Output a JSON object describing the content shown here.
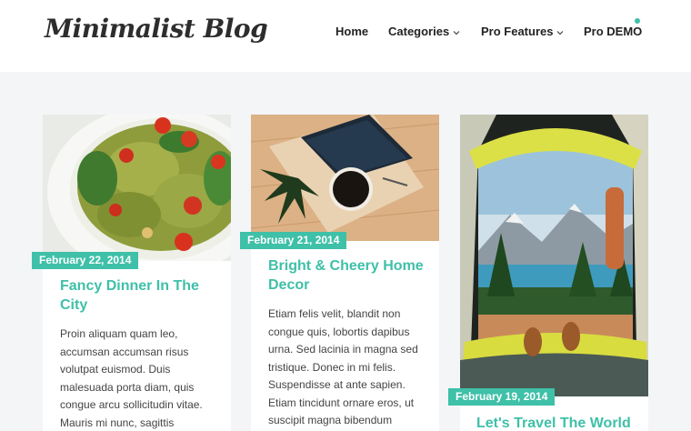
{
  "site": {
    "logo_text": "Minimalist Blog"
  },
  "nav": {
    "items": [
      {
        "label": "Home",
        "has_dropdown": false
      },
      {
        "label": "Categories",
        "has_dropdown": true
      },
      {
        "label": "Pro Features",
        "has_dropdown": true
      },
      {
        "label": "Pro DEMO",
        "has_dropdown": false,
        "indicator_dot": true
      }
    ]
  },
  "colors": {
    "accent": "#3fc0a8",
    "title": "#3fc0a8",
    "text": "#444444",
    "nav_text": "#222222",
    "background": "#f3f5f7"
  },
  "posts": [
    {
      "date": "February 22, 2014",
      "title": "Fancy Dinner In The City",
      "image": "pasta-salad-photo",
      "excerpt": "Proin aliquam quam leo, accumsan accumsan risus volutpat euismod. Duis malesuada porta diam, quis congue arcu sollicitudin vitae. Mauris mi nunc, sagittis"
    },
    {
      "date": "February 21, 2014",
      "title": "Bright & Cheery Home Decor",
      "image": "desk-coffee-tablet-photo",
      "excerpt": "Etiam felis velit, blandit non congue quis, lobortis dapibus urna. Sed lacinia in magna sed tristique. Donec in mi felis. Suspendisse at ante sapien. Etiam tincidunt ornare eros, ut suscipit magna bibendum"
    },
    {
      "date": "February 19, 2014",
      "title": "Let's Travel The World",
      "image": "tent-mountain-lake-photo",
      "excerpt": ""
    }
  ]
}
